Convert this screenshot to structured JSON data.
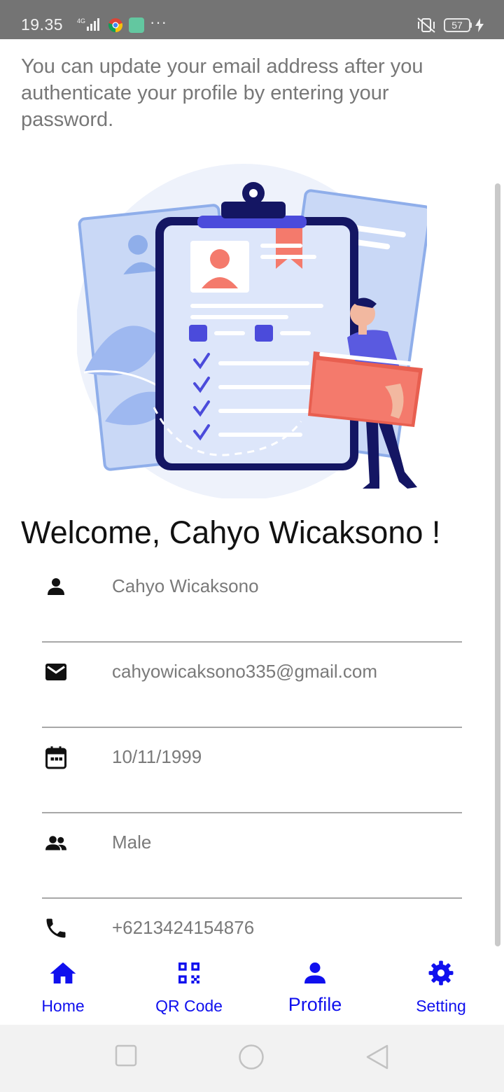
{
  "status_bar": {
    "time": "19.35",
    "network": "4G",
    "battery": "57",
    "icons": [
      "signal-icon",
      "chrome-icon",
      "app-notification-icon",
      "more-icon",
      "vibrate-off-icon",
      "battery-icon",
      "charging-icon"
    ]
  },
  "info_text": "You can update your email address after you authenticate your profile by entering your password.",
  "welcome": "Welcome, Cahyo Wicaksono !",
  "fields": {
    "name": {
      "icon": "person-icon",
      "value": "Cahyo Wicaksono"
    },
    "email": {
      "icon": "mail-icon",
      "value": "cahyowicaksono335@gmail.com"
    },
    "birthdate": {
      "icon": "calendar-icon",
      "value": "10/11/1999"
    },
    "gender": {
      "icon": "people-icon",
      "value": "Male"
    },
    "phone": {
      "icon": "phone-icon",
      "value": "+6213424154876"
    }
  },
  "bottom_nav": {
    "items": [
      {
        "label": "Home",
        "icon": "home-icon"
      },
      {
        "label": "QR Code",
        "icon": "qr-code-icon"
      },
      {
        "label": "Profile",
        "icon": "person-icon",
        "active": true
      },
      {
        "label": "Setting",
        "icon": "gear-icon"
      }
    ]
  },
  "colors": {
    "accent": "#1010ee",
    "text_secondary": "#777777",
    "status_bar": "#747474"
  }
}
